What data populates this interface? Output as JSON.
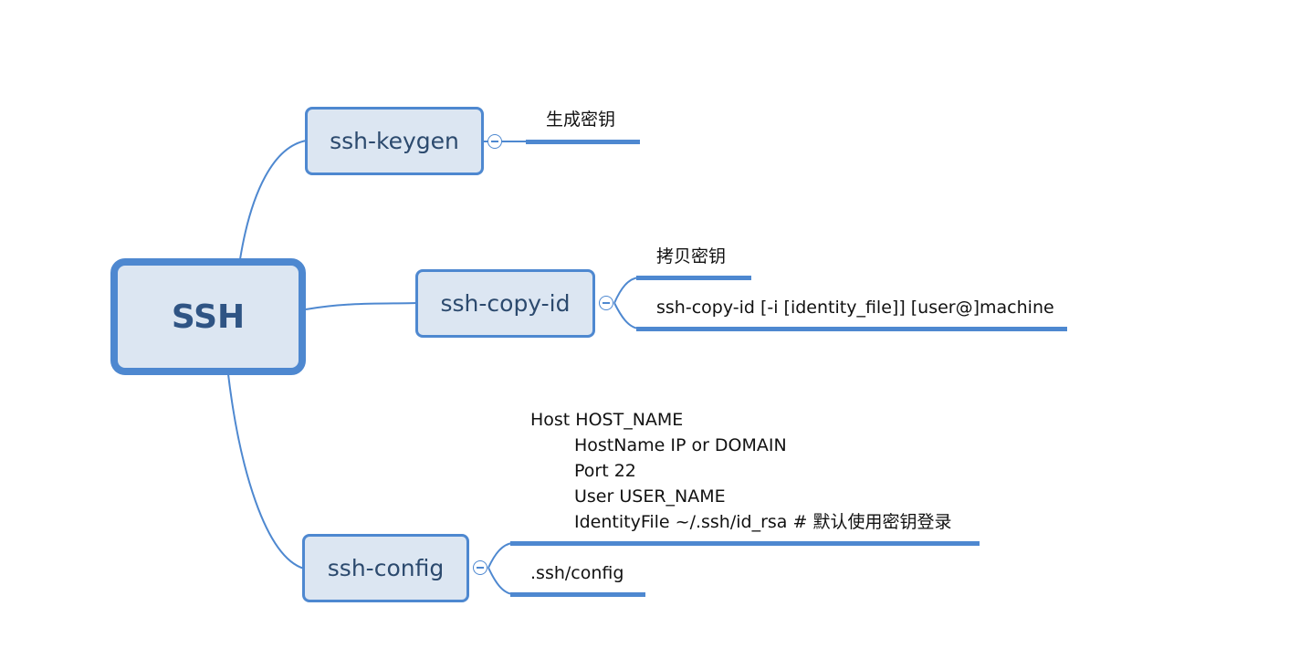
{
  "root": {
    "label": "SSH"
  },
  "branches": [
    {
      "label": "ssh-keygen",
      "leaves": [
        {
          "text": "生成密钥"
        }
      ]
    },
    {
      "label": "ssh-copy-id",
      "leaves": [
        {
          "text": "拷贝密钥"
        },
        {
          "text": "ssh-copy-id [-i [identity_file]] [user@]machine"
        }
      ]
    },
    {
      "label": "ssh-config",
      "leaves": [
        {
          "lines": [
            "Host HOST_NAME",
            "HostName IP or DOMAIN",
            "Port 22",
            "User USER_NAME",
            "IdentityFile ~/.ssh/id_rsa # 默认使用密钥登录"
          ]
        },
        {
          "text": ".ssh/config"
        }
      ]
    }
  ],
  "colors": {
    "accent": "#4e88d0",
    "node_fill": "#dce6f2",
    "node_text": "#2c4a6e"
  },
  "icons": {
    "collapse": "minus-circle-icon"
  }
}
